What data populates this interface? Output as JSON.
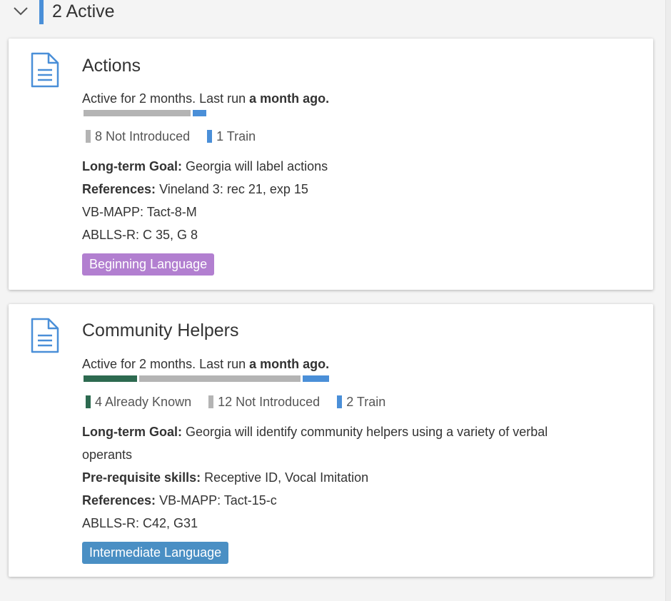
{
  "header": {
    "title": "2 Active",
    "accent_color": "#4a8fd8"
  },
  "cards": [
    {
      "title": "Actions",
      "status": {
        "prefix": "Active for 2 months. Last run ",
        "emphasis": "a month ago."
      },
      "progress": [
        {
          "label": "Not Introduced",
          "count": 8,
          "color": "#b4b4b4"
        },
        {
          "label": "Train",
          "count": 1,
          "color": "#4a8fd8"
        }
      ],
      "legend": [
        {
          "text": "8 Not Introduced",
          "color": "#b4b4b4"
        },
        {
          "text": "1 Train",
          "color": "#4a8fd8"
        }
      ],
      "goal": {
        "label": "Long-term Goal:",
        "text": " Georgia will label actions"
      },
      "references": {
        "label": "References:",
        "lines": [
          "Vineland 3: rec 21, exp 15",
          "VB-MAPP: Tact-8-M",
          "ABLLS-R: C 35, G 8"
        ]
      },
      "tag": {
        "text": "Beginning Language",
        "color": "#b27fd0"
      }
    },
    {
      "title": "Community Helpers",
      "status": {
        "prefix": "Active for 2 months. Last run ",
        "emphasis": "a month ago."
      },
      "progress": [
        {
          "label": "Already Known",
          "count": 4,
          "color": "#2d6a50"
        },
        {
          "label": "Not Introduced",
          "count": 12,
          "color": "#b4b4b4"
        },
        {
          "label": "Train",
          "count": 2,
          "color": "#4a8fd8"
        }
      ],
      "legend": [
        {
          "text": "4 Already Known",
          "color": "#2d6a50"
        },
        {
          "text": "12 Not Introduced",
          "color": "#b4b4b4"
        },
        {
          "text": "2 Train",
          "color": "#4a8fd8"
        }
      ],
      "goal": {
        "label": "Long-term Goal:",
        "text": " Georgia will identify community helpers using a variety of verbal",
        "text2": "operants"
      },
      "prereq": {
        "label": "Pre-requisite skills:",
        "text": " Receptive ID, Vocal Imitation"
      },
      "references": {
        "label": "References:",
        "lines": [
          "VB-MAPP: Tact-15-c",
          "ABLLS-R: C42, G31"
        ]
      },
      "tag": {
        "text": "Intermediate Language",
        "color": "#4a8fc4"
      }
    }
  ]
}
